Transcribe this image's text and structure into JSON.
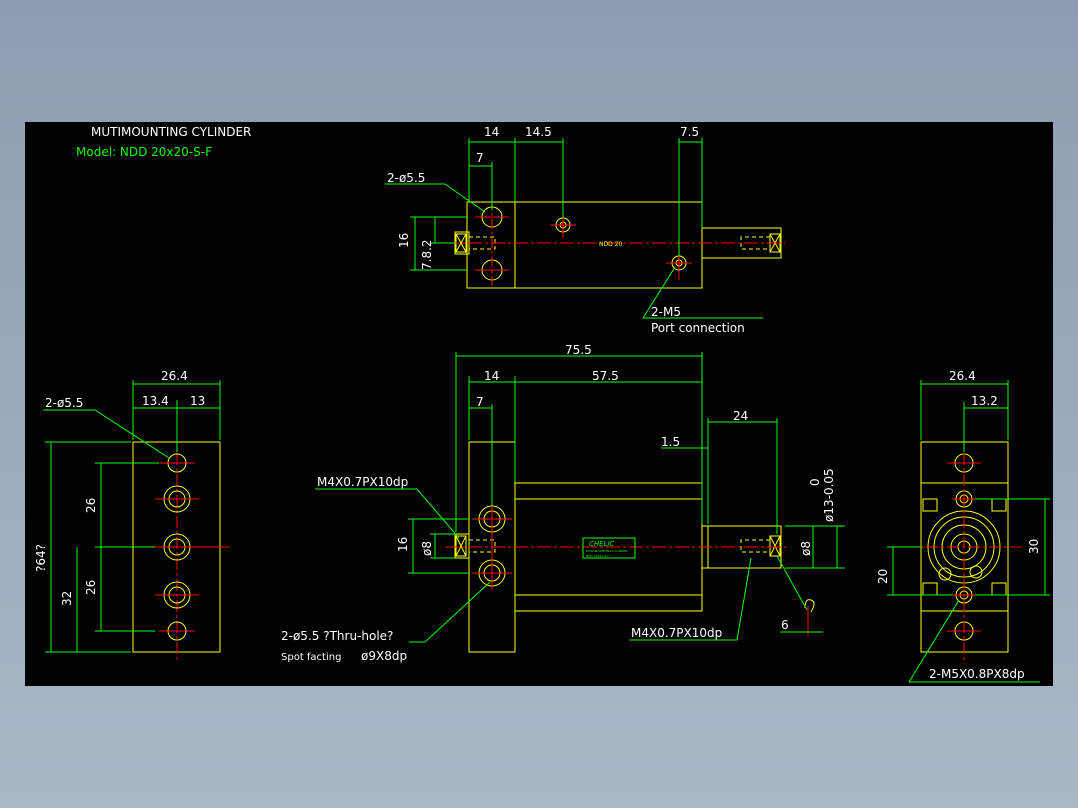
{
  "colors": {
    "object": "#ffff00",
    "dimension": "#00ff00",
    "center": "#ff0000",
    "text": "#ffffff",
    "background": "#000000"
  },
  "title": {
    "line1": "MUTIMOUNTING CYLINDER",
    "line2": "Model: NDD 20x20-S-F"
  },
  "top_view": {
    "dims": {
      "d14": "14",
      "d14_5": "14.5",
      "d7_5": "7.5",
      "d7": "7",
      "d16": "16",
      "d7_8_2": "7.8.2"
    },
    "labels": {
      "holes": "2-ø5.5",
      "port": "2-M5",
      "port_desc": "Port connection",
      "model_mark": "NDD 20"
    }
  },
  "left_view": {
    "dims": {
      "w26_4": "26.4",
      "w13_4": "13.4",
      "w13": "13",
      "h26a": "26",
      "h26b": "26",
      "h32": "32",
      "h64": "?64?"
    },
    "labels": {
      "holes": "2-ø5.5"
    }
  },
  "front_view": {
    "dims": {
      "d75_5": "75.5",
      "d14": "14",
      "d57_5": "57.5",
      "d7": "7",
      "d24": "24",
      "d1_5": "1.5",
      "d16": "16",
      "d8a": "ø8",
      "d8b": "ø8",
      "d13": "ø13-0.05",
      "d13_0": "0",
      "d6": "6"
    },
    "labels": {
      "thread_left": "M4X0.7PX10dp",
      "thread_right": "M4X0.7PX10dp",
      "holes": "2-ø5.5 ?Thru-hole?",
      "spot": "Spot facting",
      "spot_dim": "ø9X8dp",
      "brand": "CHELIC",
      "brand_sub": "MULTIMOUNTING CYLINDER",
      "brand_model": "NDD 20x20-S-F"
    }
  },
  "right_view": {
    "dims": {
      "w26_4": "26.4",
      "w13_2": "13.2",
      "h30": "30",
      "h20": "20"
    },
    "labels": {
      "thread": "2-M5X0.8PX8dp"
    }
  }
}
